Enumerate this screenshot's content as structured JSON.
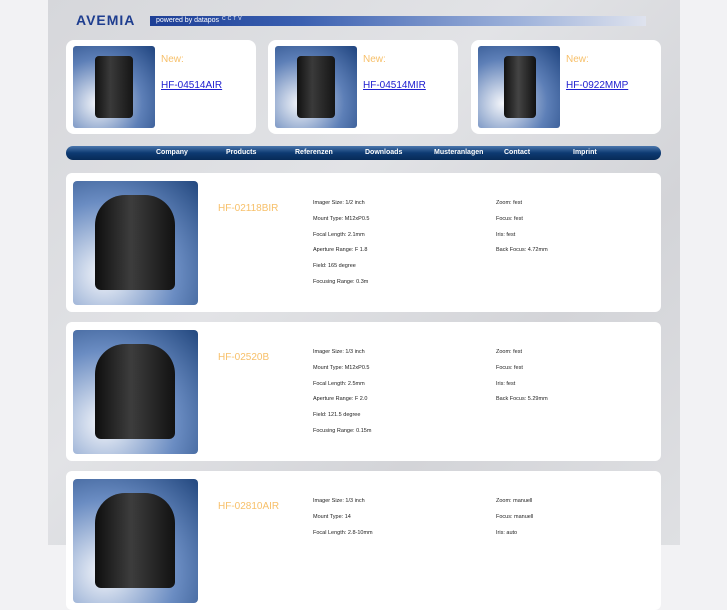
{
  "header": {
    "logo": "AVEMIA",
    "powered": "powered by datapos",
    "cctv": "CCTV"
  },
  "new_items": [
    {
      "label": "New:",
      "link": "HF-04514AIR"
    },
    {
      "label": "New:",
      "link": "HF-04514MIR"
    },
    {
      "label": "New:",
      "link": "HF-0922MMP"
    }
  ],
  "nav": [
    "Company",
    "Products",
    "Referenzen",
    "Downloads",
    "Musteranlagen",
    "Contact",
    "Imprint"
  ],
  "products": [
    {
      "name": "HF-02118BIR",
      "left": [
        "Imager Size: 1/2 inch",
        "Mount Type: M12xP0.5",
        "Focal Length: 2.1mm",
        "Aperture Range: F 1.8",
        "Field: 165 degree",
        "Focusing Range: 0.3m"
      ],
      "right": [
        "Zoom: fest",
        "Focus: fest",
        "Iris: fest",
        "Back Focus: 4.72mm"
      ]
    },
    {
      "name": "HF-02520B",
      "left": [
        "Imager Size: 1/3 inch",
        "Mount Type: M12xP0.5",
        "Focal Length: 2.5mm",
        "Aperture Range: F 2.0",
        "Field: 121.5 degree",
        "Focusing Range: 0.15m"
      ],
      "right": [
        "Zoom: fest",
        "Focus: fest",
        "Iris: fest",
        "Back Focus: 5.29mm"
      ]
    },
    {
      "name": "HF-02810AIR",
      "left": [
        "Imager Size: 1/3 inch",
        "Mount Type: 14",
        "Focal Length: 2.8-10mm"
      ],
      "right": [
        "Zoom: manuell",
        "Focus: manuell",
        "Iris: auto"
      ]
    }
  ]
}
